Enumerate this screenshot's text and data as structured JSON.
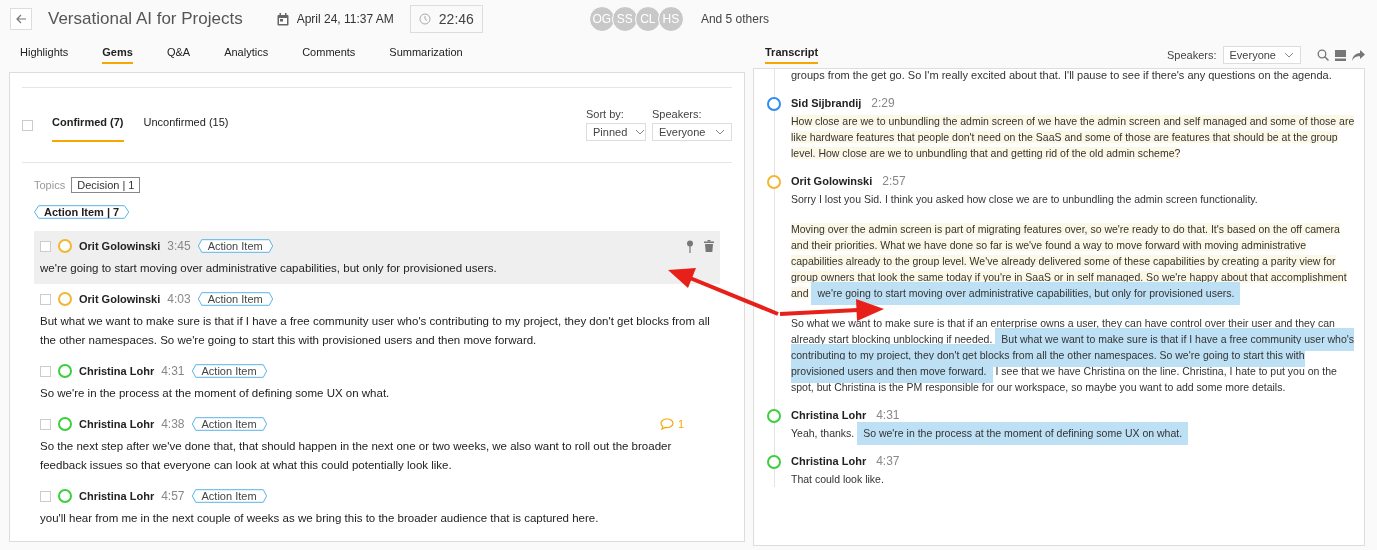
{
  "header": {
    "title": "Versational AI for Projects",
    "date": "April 24, 11:37 AM",
    "duration": "22:46",
    "participants": [
      {
        "initials": "OG"
      },
      {
        "initials": "SS"
      },
      {
        "initials": "CL"
      },
      {
        "initials": "HS"
      }
    ],
    "others": "And 5 others"
  },
  "tabs": [
    {
      "label": "Highlights",
      "selected": false
    },
    {
      "label": "Gems",
      "selected": true
    },
    {
      "label": "Q&A",
      "selected": false
    },
    {
      "label": "Analytics",
      "selected": false
    },
    {
      "label": "Comments",
      "selected": false
    },
    {
      "label": "Summarization",
      "selected": false
    }
  ],
  "transcript_tab": {
    "label": "Transcript",
    "selected": true
  },
  "transcript_toolbar": {
    "speakers_label": "Speakers:",
    "speakers_value": "Everyone"
  },
  "gems": {
    "select_all_checked": false,
    "filters": [
      {
        "label": "Confirmed (7)",
        "selected": true
      },
      {
        "label": "Unconfirmed (15)",
        "selected": false
      }
    ],
    "sort_label": "Sort by:",
    "sort_value": "Pinned",
    "speakers_label": "Speakers:",
    "speakers_value": "Everyone",
    "topics_label": "Topics",
    "topics": [
      {
        "label": "Decision | 1"
      }
    ],
    "group_tag": "Action Item | 7",
    "items": [
      {
        "speaker": "Orit Golowinski",
        "color": "#f2b632",
        "time": "3:45",
        "tag": "Action Item",
        "checked": false,
        "hovered": true,
        "text": "we're going to start moving over administrative capabilities, but only for provisioned users."
      },
      {
        "speaker": "Orit Golowinski",
        "color": "#f2b632",
        "time": "4:03",
        "tag": "Action Item",
        "checked": false,
        "hovered": false,
        "text": "But what we want to make sure is that if I have a free community user who's contributing to my project, they don't get blocks from all the other namespaces. So we're going to start this with provisioned users and then move forward."
      },
      {
        "speaker": "Christina Lohr",
        "color": "#3ccf3c",
        "time": "4:31",
        "tag": "Action Item",
        "checked": false,
        "hovered": false,
        "text": "So we're in the process at the moment of defining some UX on what."
      },
      {
        "speaker": "Christina Lohr",
        "color": "#3ccf3c",
        "time": "4:38",
        "tag": "Action Item",
        "checked": false,
        "hovered": false,
        "comments": "1",
        "text": "So the next step after we've done that, that should happen in the next one or two weeks, we also want to roll out the broader feedback issues so that everyone can look at what this could potentially look like."
      },
      {
        "speaker": "Christina Lohr",
        "color": "#3ccf3c",
        "time": "4:57",
        "tag": "Action Item",
        "checked": false,
        "hovered": false,
        "text": "you'll hear from me in the next couple of weeks as we bring this to the broader audience that is captured here."
      }
    ]
  },
  "transcript": {
    "lead": "groups from the get go. So I'm really excited about that. I'll pause to see if there's any questions on the agenda.",
    "entries": [
      {
        "speaker": "Sid Sijbrandij",
        "color": "#2d8cf0",
        "time": "2:29",
        "paragraphs": [
          [
            {
              "text": "How close are we to unbundling the admin screen of we have the admin screen and self managed and some of those are like hardware features that people don't need on the SaaS and some of those are features that should be at the group level. How close are we to unbundling that and getting rid of the old admin scheme?",
              "kind": "soft"
            }
          ]
        ]
      },
      {
        "speaker": "Orit Golowinski",
        "color": "#f2b632",
        "time": "2:57",
        "paragraphs": [
          [
            {
              "text": "Sorry I lost you Sid. I think you asked how close we are to unbundling the admin screen functionality.",
              "kind": "plain"
            }
          ],
          [
            {
              "text": "Moving over the admin screen is part of migrating features over, so we're ready to do that. It's based on the off camera and their priorities. What we have done so far is we've found a way to move forward with moving administrative capabilities already to the group level. We've already delivered some of these capabilities by creating a parity view for group owners that look the same today if you're in SaaS or in self managed. So we're happy about that accomplishment and",
              "kind": "soft"
            },
            {
              "text": "we're going to start moving over administrative capabilities, but only for provisioned users.",
              "kind": "gem"
            }
          ],
          [
            {
              "text": "So what we want to make sure is that if an enterprise owns a user, they can have control over their user and they can already start blocking unblocking if needed.",
              "kind": "plain"
            },
            {
              "text": "But what we want to make sure is that if I have a free community user who's contributing to my project, they don't get blocks from all the other namespaces. So we're going to start this with provisioned users and then move forward.",
              "kind": "gem"
            },
            {
              "text": "I see that we have Christina on the line. Christina, I hate to put you on the spot, but Christina is the PM responsible for our workspace, so maybe you want to add some more details.",
              "kind": "plain"
            }
          ]
        ]
      },
      {
        "speaker": "Christina Lohr",
        "color": "#3ccf3c",
        "time": "4:31",
        "paragraphs": [
          [
            {
              "text": "Yeah, thanks.",
              "kind": "plain"
            },
            {
              "text": "So we're in the process at the moment of defining some UX on what.",
              "kind": "gem"
            }
          ]
        ]
      },
      {
        "speaker": "Christina Lohr",
        "color": "#3ccf3c",
        "time": "4:37",
        "paragraphs": [
          [
            {
              "text": "That could look like.",
              "kind": "plain"
            }
          ]
        ]
      }
    ]
  }
}
